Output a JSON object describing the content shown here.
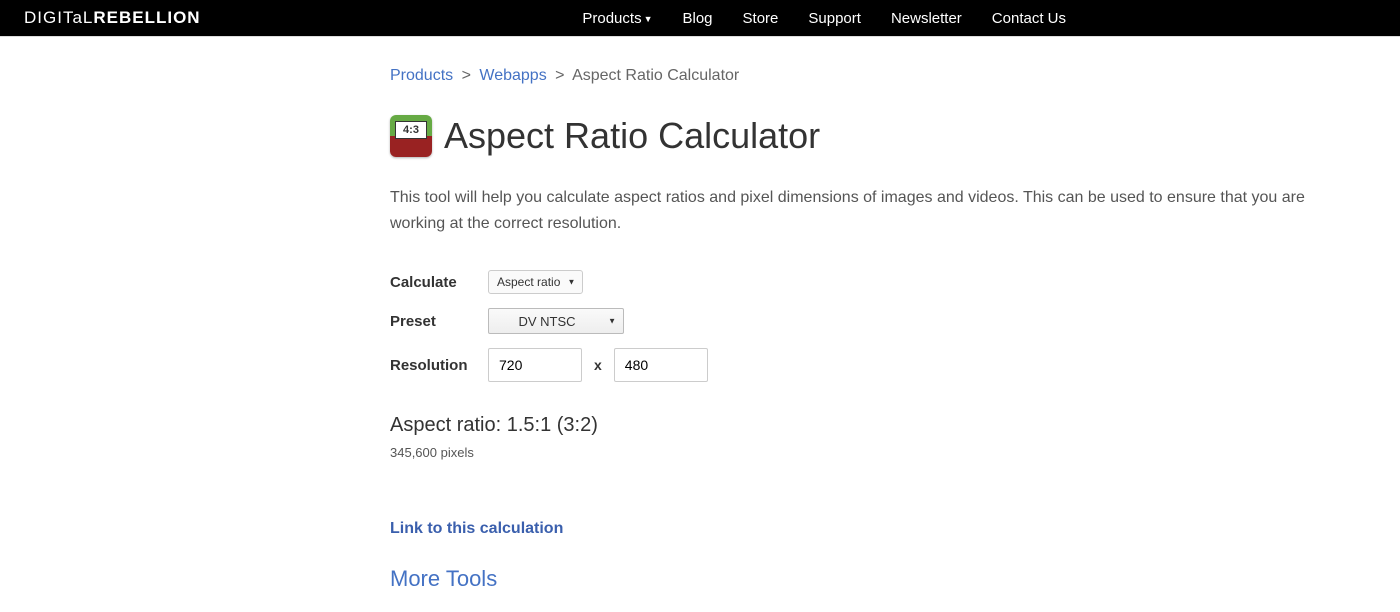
{
  "logo": {
    "thin": "DIGITaL",
    "bold": "REBELLION"
  },
  "nav": {
    "products": "Products",
    "blog": "Blog",
    "store": "Store",
    "support": "Support",
    "newsletter": "Newsletter",
    "contact": "Contact Us"
  },
  "breadcrumb": {
    "products": "Products",
    "webapps": "Webapps",
    "current": "Aspect Ratio Calculator"
  },
  "page": {
    "title": "Aspect Ratio Calculator",
    "icon_ratio": "4:3",
    "description": "This tool will help you calculate aspect ratios and pixel dimensions of images and videos. This can be used to ensure that you are working at the correct resolution."
  },
  "form": {
    "calculate_label": "Calculate",
    "calculate_value": "Aspect ratio",
    "preset_label": "Preset",
    "preset_value": "DV NTSC",
    "resolution_label": "Resolution",
    "width": "720",
    "height": "480",
    "x": "x"
  },
  "result": {
    "ratio": "Aspect ratio: 1.5:1 (3:2)",
    "pixels": "345,600 pixels"
  },
  "links": {
    "link_calc": "Link to this calculation",
    "more_tools": "More Tools"
  }
}
